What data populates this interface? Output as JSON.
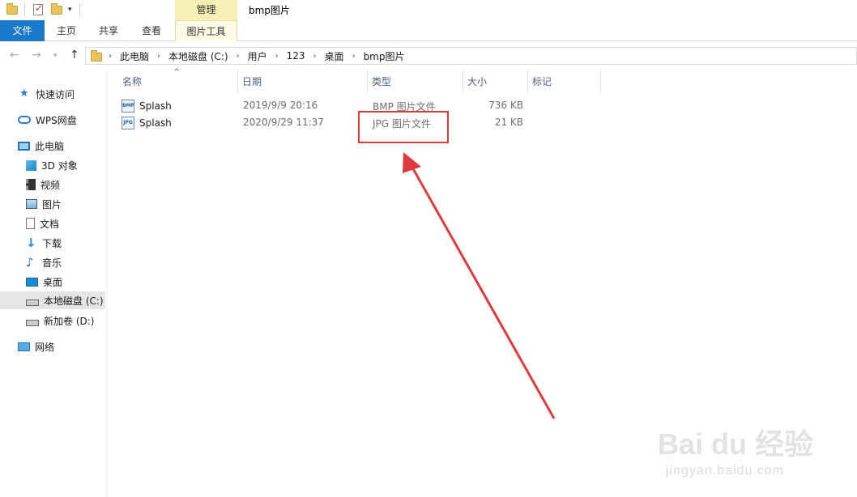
{
  "window": {
    "title": "bmp图片",
    "context_group": "管理"
  },
  "ribbon": {
    "tabs": [
      {
        "label": "文件"
      },
      {
        "label": "主页"
      },
      {
        "label": "共享"
      },
      {
        "label": "查看"
      },
      {
        "label": "图片工具"
      }
    ]
  },
  "address": {
    "crumbs": [
      "此电脑",
      "本地磁盘 (C:)",
      "用户",
      "123",
      "桌面",
      "bmp图片"
    ]
  },
  "sidebar": {
    "items": [
      {
        "label": "快速访问",
        "icon": "star-icon"
      },
      {
        "label": "WPS网盘",
        "icon": "cloud-icon"
      },
      {
        "label": "此电脑",
        "icon": "computer-icon"
      },
      {
        "label": "3D 对象",
        "icon": "3d-objects-icon"
      },
      {
        "label": "视频",
        "icon": "video-icon"
      },
      {
        "label": "图片",
        "icon": "pictures-icon"
      },
      {
        "label": "文档",
        "icon": "documents-icon"
      },
      {
        "label": "下载",
        "icon": "download-icon"
      },
      {
        "label": "音乐",
        "icon": "music-icon"
      },
      {
        "label": "桌面",
        "icon": "desktop-icon"
      },
      {
        "label": "本地磁盘 (C:)",
        "icon": "drive-icon",
        "selected": true
      },
      {
        "label": "新加卷 (D:)",
        "icon": "drive-icon"
      },
      {
        "label": "网络",
        "icon": "network-icon"
      }
    ]
  },
  "columns": [
    {
      "label": "名称"
    },
    {
      "label": "日期"
    },
    {
      "label": "类型"
    },
    {
      "label": "大小"
    },
    {
      "label": "标记"
    }
  ],
  "files": [
    {
      "name": "Splash",
      "badge": "BMP",
      "date": "2019/9/9 20:16",
      "type": "BMP 图片文件",
      "size": "736 KB"
    },
    {
      "name": "Splash",
      "badge": "JPG",
      "date": "2020/9/29 11:37",
      "type": "JPG 图片文件",
      "size": "21 KB"
    }
  ],
  "watermark": {
    "brand": "Bai du 经验",
    "site": "jingyan.baidu.com"
  },
  "colors": {
    "file_tab": "#1979ca",
    "manage_tab": "#f7f0b4",
    "annotation": "#e0393b"
  }
}
